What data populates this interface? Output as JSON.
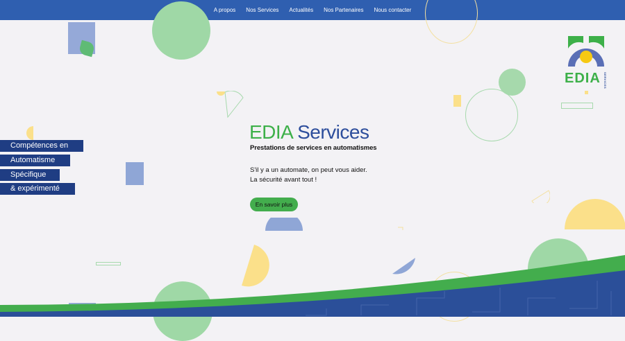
{
  "nav": {
    "items": [
      {
        "label": "A propos"
      },
      {
        "label": "Nos Services"
      },
      {
        "label": "Actualités"
      },
      {
        "label": "Nos Partenaires"
      },
      {
        "label": "Nous contacter"
      }
    ]
  },
  "hero": {
    "title_part1": "EDIA",
    "title_part2": "Services",
    "subtitle": "Prestations de services en automatismes",
    "line1": "S'il y a un automate, on peut vous aider.",
    "line2": "La sécurité avant tout !",
    "cta_label": "En savoir plus"
  },
  "tags": [
    {
      "label": "Compétences en"
    },
    {
      "label": "Automatisme"
    },
    {
      "label": "Spécifique"
    },
    {
      "label": "& expérimenté"
    }
  ],
  "logo": {
    "text": "EDIA",
    "side_text": "SERVICES"
  },
  "colors": {
    "nav_bg": "#2f5fb0",
    "green": "#3db049",
    "blue": "#2d4e9c",
    "tag_bg": "#1f3d83",
    "yellow": "#fbe08a",
    "light_green": "#9dd6a3",
    "light_blue": "#8fa6d6"
  }
}
